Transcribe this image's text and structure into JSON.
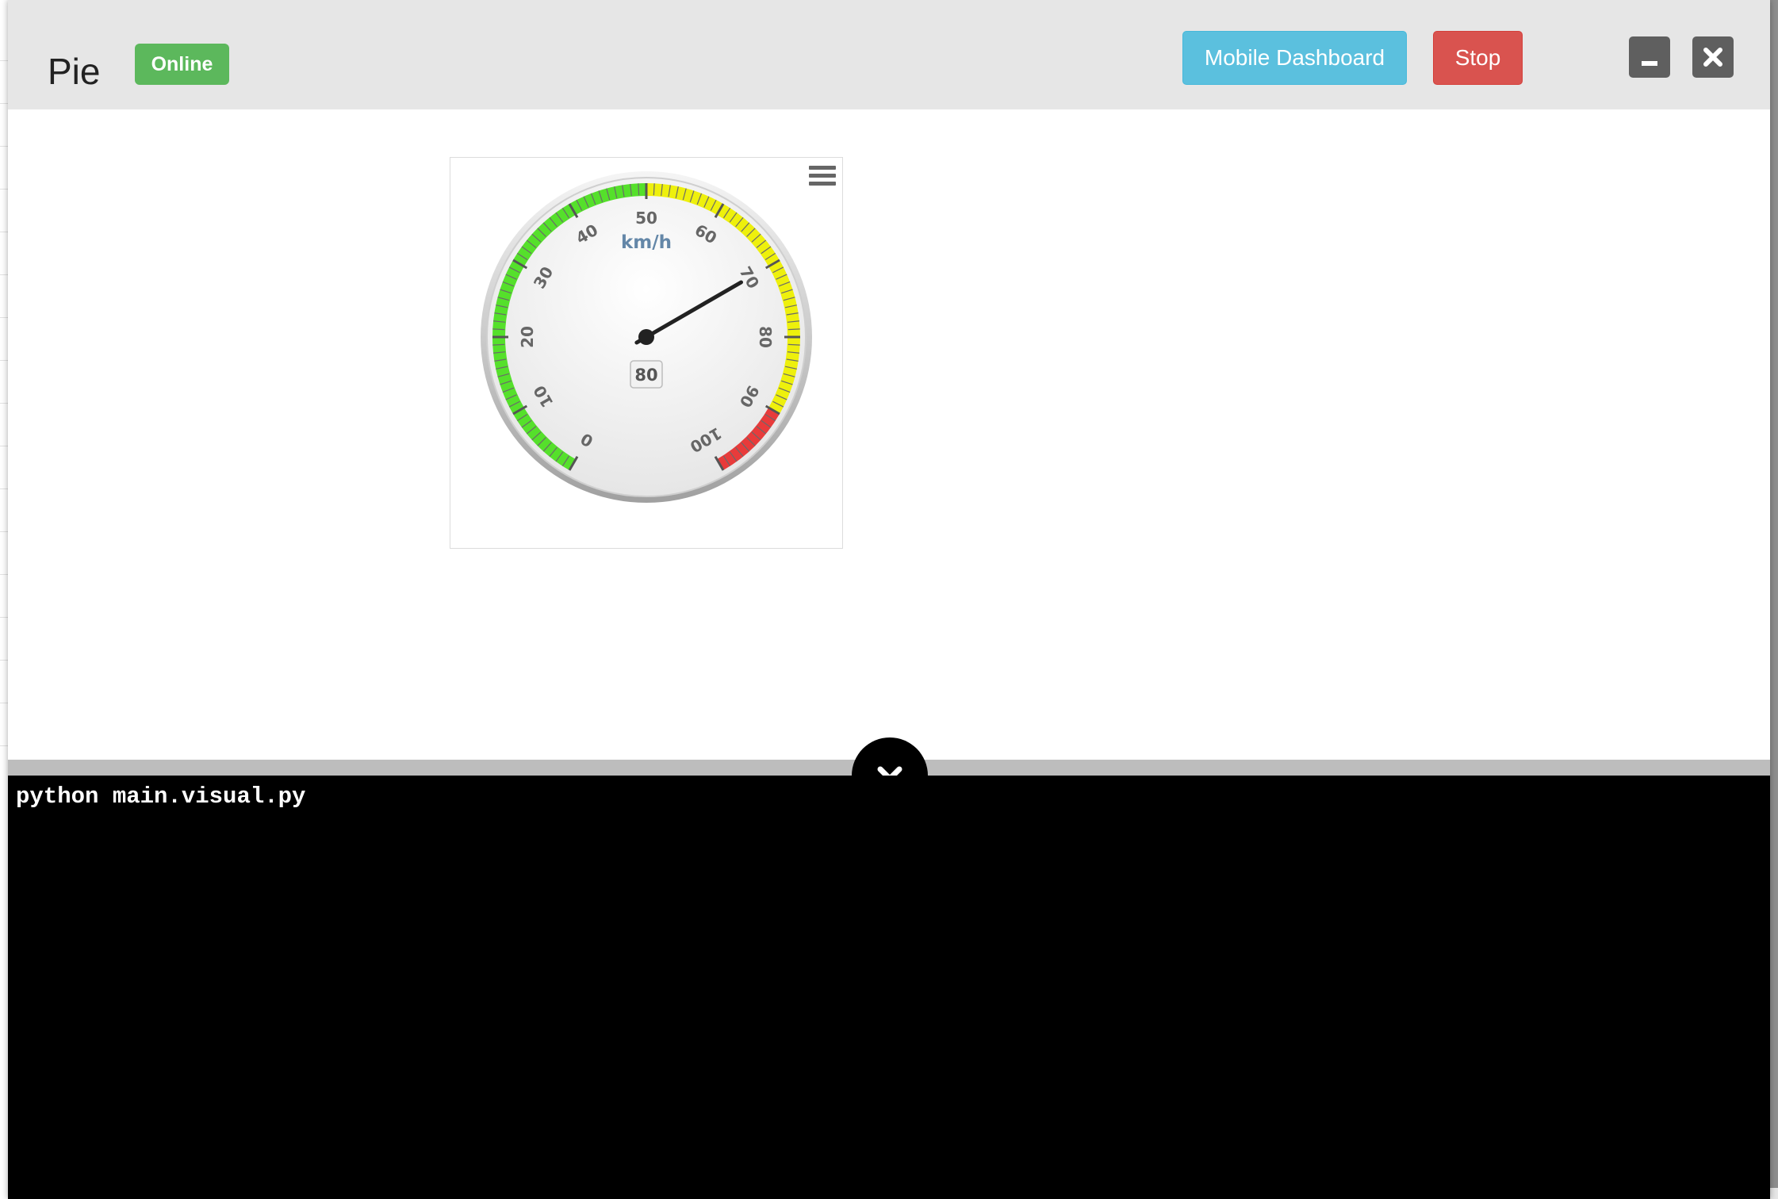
{
  "modal": {
    "title": "Pie",
    "status_badge": "Online",
    "mobile_dashboard_label": "Mobile Dashboard",
    "stop_label": "Stop",
    "minimize_icon": "minimize-icon",
    "close_icon": "close-icon"
  },
  "gauge": {
    "unit": "km/h",
    "value_label": "80",
    "menu_icon": "hamburger-icon"
  },
  "chart_data": {
    "type": "gauge",
    "min": 0,
    "max": 100,
    "value": 70,
    "unit": "km/h",
    "tick_labels": [
      "0",
      "10",
      "20",
      "30",
      "40",
      "50",
      "60",
      "70",
      "80",
      "90",
      "100"
    ],
    "bands": [
      {
        "from": 0,
        "to": 50,
        "color": "#55e02b"
      },
      {
        "from": 50,
        "to": 90,
        "color": "#eef00c"
      },
      {
        "from": 90,
        "to": 100,
        "color": "#e83b3b"
      }
    ]
  },
  "console": {
    "toggle_icon": "chevron-down-icon",
    "line": "python main.visual.py"
  },
  "colors": {
    "online": "#5cb85c",
    "mobile_dashboard": "#5bc0de",
    "stop": "#d9534f"
  }
}
